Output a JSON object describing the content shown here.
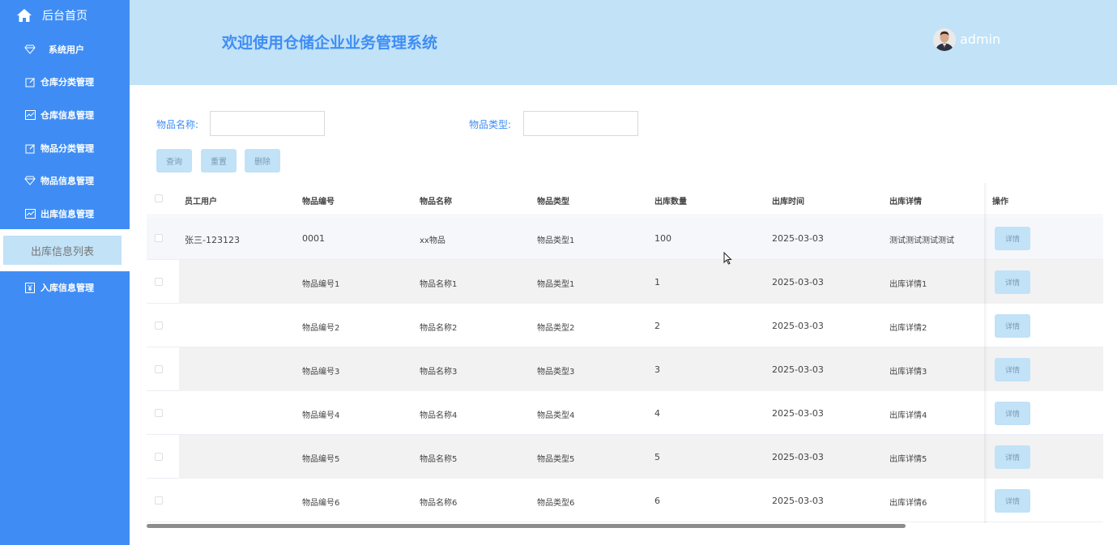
{
  "sidebar": {
    "home_label": "后台首页",
    "items": [
      {
        "label": "系统用户",
        "icon": "diamond-icon"
      },
      {
        "label": "仓库分类管理",
        "icon": "edit-icon"
      },
      {
        "label": "仓库信息管理",
        "icon": "chart-icon"
      },
      {
        "label": "物品分类管理",
        "icon": "edit-icon"
      },
      {
        "label": "物品信息管理",
        "icon": "diamond-icon"
      },
      {
        "label": "出库信息管理",
        "icon": "chart-icon"
      },
      {
        "label": "入库信息管理",
        "icon": "yen-icon"
      }
    ],
    "active_sub_label": "出库信息列表"
  },
  "header": {
    "title": "欢迎使用仓储企业业务管理系统",
    "username": "admin"
  },
  "search": {
    "name_label": "物品名称:",
    "name_value": "",
    "type_label": "物品类型:",
    "type_value": "",
    "query_label": "查询",
    "reset_label": "重置",
    "delete_label": "删除"
  },
  "table": {
    "columns": [
      "员工用户",
      "物品编号",
      "物品名称",
      "物品类型",
      "出库数量",
      "出库时间",
      "出库详情",
      "操作"
    ],
    "detail_label": "详情",
    "rows": [
      [
        "张三-123123",
        "0001",
        "xx物品",
        "物品类型1",
        "100",
        "2025-03-03",
        "测试测试测试测试"
      ],
      [
        "",
        "物品编号1",
        "物品名称1",
        "物品类型1",
        "1",
        "2025-03-03",
        "出库详情1"
      ],
      [
        "",
        "物品编号2",
        "物品名称2",
        "物品类型2",
        "2",
        "2025-03-03",
        "出库详情2"
      ],
      [
        "",
        "物品编号3",
        "物品名称3",
        "物品类型3",
        "3",
        "2025-03-03",
        "出库详情3"
      ],
      [
        "",
        "物品编号4",
        "物品名称4",
        "物品类型4",
        "4",
        "2025-03-03",
        "出库详情4"
      ],
      [
        "",
        "物品编号5",
        "物品名称5",
        "物品类型5",
        "5",
        "2025-03-03",
        "出库详情5"
      ],
      [
        "",
        "物品编号6",
        "物品名称6",
        "物品类型6",
        "6",
        "2025-03-03",
        "出库详情6"
      ]
    ]
  },
  "colors": {
    "primary": "#3f8df4",
    "light": "#c1e2f7"
  }
}
